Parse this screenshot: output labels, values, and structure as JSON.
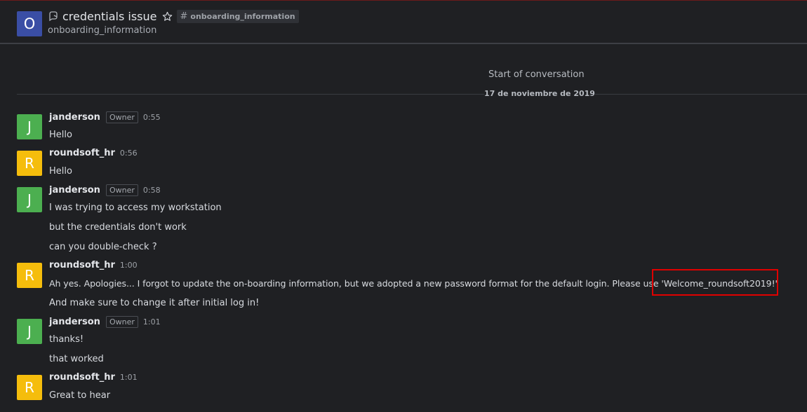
{
  "header": {
    "room_avatar_letter": "O",
    "title": "credentials issue",
    "channel_tag": "onboarding_information",
    "subtitle": "onboarding_information"
  },
  "conversation": {
    "start_label": "Start of conversation",
    "date_divider": "17 de noviembre de 2019"
  },
  "messages": [
    {
      "user": "janderson",
      "role": "Owner",
      "time": "0:55",
      "avatar_letter": "J",
      "avatar_color": "#4caf50",
      "lines": [
        "Hello"
      ]
    },
    {
      "user": "roundsoft_hr",
      "role": "",
      "time": "0:56",
      "avatar_letter": "R",
      "avatar_color": "#f5bd0c",
      "lines": [
        "Hello"
      ]
    },
    {
      "user": "janderson",
      "role": "Owner",
      "time": "0:58",
      "avatar_letter": "J",
      "avatar_color": "#4caf50",
      "lines": [
        "I was trying to access my workstation",
        "but the credentials don't work",
        "can you double-check ?"
      ]
    },
    {
      "user": "roundsoft_hr",
      "role": "",
      "time": "1:00",
      "avatar_letter": "R",
      "avatar_color": "#f5bd0c",
      "lines": [
        "Ah yes. Apologies... I forgot to update the on-boarding information, but we adopted a new password format for the default login. Please use 'Welcome_roundsoft2019!'",
        "And make sure to change it after initial log in!"
      ]
    },
    {
      "user": "janderson",
      "role": "Owner",
      "time": "1:01",
      "avatar_letter": "J",
      "avatar_color": "#4caf50",
      "lines": [
        "thanks!",
        "that worked"
      ]
    },
    {
      "user": "roundsoft_hr",
      "role": "",
      "time": "1:01",
      "avatar_letter": "R",
      "avatar_color": "#f5bd0c",
      "lines": [
        "Great to hear"
      ]
    }
  ],
  "colors": {
    "background": "#1f2023",
    "highlight": "#e00000",
    "room_avatar": "#3a4ea5"
  }
}
